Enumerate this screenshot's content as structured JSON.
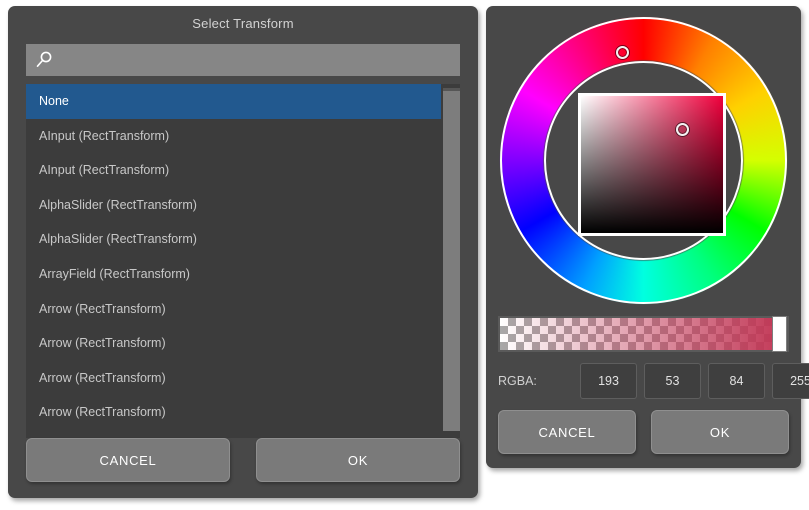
{
  "transform_dialog": {
    "title": "Select Transform",
    "search": {
      "placeholder": "",
      "value": "",
      "icon": "search-icon"
    },
    "list": {
      "selected_index": 0,
      "items": [
        {
          "label": "None",
          "selected": true
        },
        {
          "label": "AInput (RectTransform)",
          "selected": false
        },
        {
          "label": "AInput (RectTransform)",
          "selected": false
        },
        {
          "label": "AlphaSlider (RectTransform)",
          "selected": false
        },
        {
          "label": "AlphaSlider (RectTransform)",
          "selected": false
        },
        {
          "label": "ArrayField (RectTransform)",
          "selected": false
        },
        {
          "label": "Arrow (RectTransform)",
          "selected": false
        },
        {
          "label": "Arrow (RectTransform)",
          "selected": false
        },
        {
          "label": "Arrow (RectTransform)",
          "selected": false
        },
        {
          "label": "Arrow (RectTransform)",
          "selected": false
        }
      ]
    },
    "buttons": {
      "cancel": "CANCEL",
      "ok": "OK"
    }
  },
  "color_picker_dialog": {
    "wheel": {
      "hue_marker_name": "hue-ring-marker",
      "sv_marker_name": "saturation-value-marker"
    },
    "alpha": {
      "handle_name": "alpha-slider-handle"
    },
    "rgba": {
      "label": "RGBA:",
      "r": "193",
      "g": "53",
      "b": "84",
      "a": "255"
    },
    "selected_color_hex": "#c13554",
    "hue_color_hex": "#f0003c",
    "buttons": {
      "cancel": "CANCEL",
      "ok": "OK"
    }
  }
}
